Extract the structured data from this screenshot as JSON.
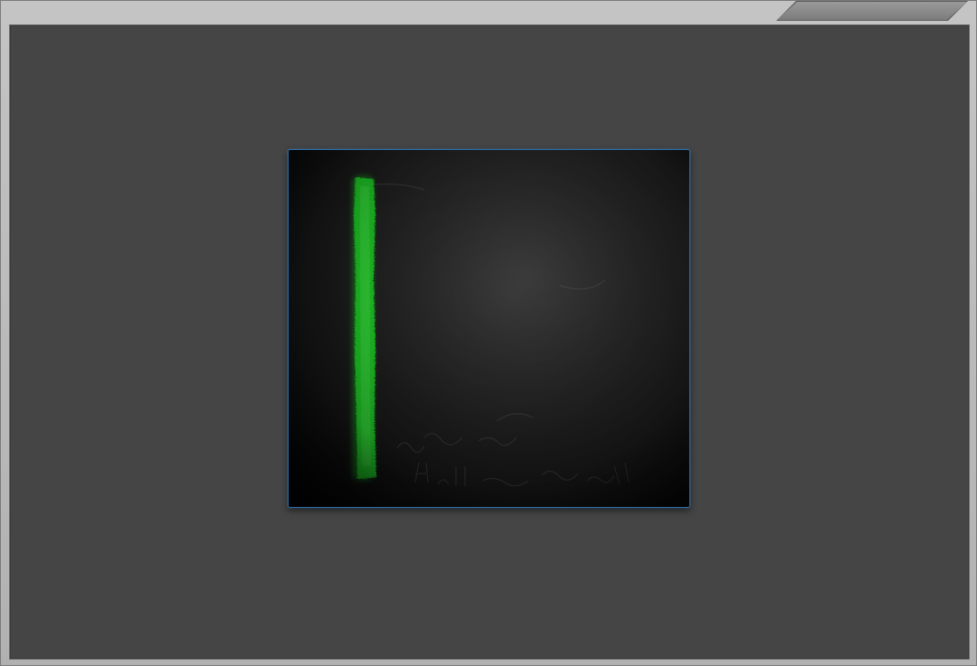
{
  "window": {
    "title_tab_label": ""
  },
  "viewer": {
    "image_description_label": "",
    "colors": {
      "background": "#454545",
      "frame_border": "#2f6fa8",
      "stroke": "#22e02a"
    }
  }
}
